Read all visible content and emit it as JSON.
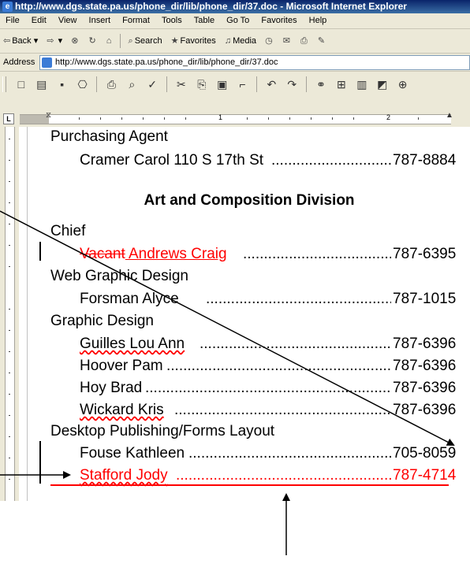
{
  "window": {
    "title": "http://www.dgs.state.pa.us/phone_dir/lib/phone_dir/37.doc - Microsoft Internet Explorer"
  },
  "menu": [
    "File",
    "Edit",
    "View",
    "Insert",
    "Format",
    "Tools",
    "Table",
    "Go To",
    "Favorites",
    "Help"
  ],
  "nav": {
    "back": "Back",
    "search": "Search",
    "favorites": "Favorites",
    "media": "Media"
  },
  "address": {
    "label": "Address",
    "url": "http://www.dgs.state.pa.us/phone_dir/lib/phone_dir/37.doc"
  },
  "ruler": {
    "marks": [
      "1",
      "2"
    ]
  },
  "document": {
    "purchasing_agent": "Purchasing Agent",
    "cramer": {
      "name": "Cramer Carol 110 S 17th St",
      "phone": "787-8884"
    },
    "division_heading": "Art and Composition Division",
    "chief": "Chief",
    "chief_entry": {
      "deleted": "Vacant",
      "inserted": " Andrews Craig",
      "phone": "787-6395"
    },
    "web_graphic_design": "Web Graphic Design",
    "forsman": {
      "name": "Forsman Alyce",
      "phone": "787-1015"
    },
    "graphic_design": "Graphic Design",
    "guilles": {
      "name": "Guilles Lou Ann",
      "phone": "787-6396"
    },
    "hoover": {
      "name": "Hoover Pam",
      "phone": "787-6396"
    },
    "hoy": {
      "name": "Hoy Brad",
      "phone": "787-6396"
    },
    "wickard": {
      "name": "Wickard Kris",
      "phone": "787-6396"
    },
    "desktop_publishing": "Desktop Publishing/Forms Layout",
    "fouse": {
      "name": "Fouse Kathleen",
      "phone": "705-8059"
    },
    "stafford": {
      "name": "Stafford Jody",
      "phone": "787-4714"
    }
  },
  "colors": {
    "titlebar": "#0A246A",
    "chrome": "#ECE9D8",
    "revision": "#FF0000"
  },
  "icons": [
    "ie-icon",
    "back-arrow-icon",
    "forward-arrow-icon",
    "stop-icon",
    "refresh-icon",
    "home-icon",
    "search-icon",
    "favorites-icon",
    "media-icon",
    "history-icon",
    "mail-icon",
    "print-icon",
    "edit-icon",
    "page-icon",
    "new-icon",
    "open-icon",
    "save-icon",
    "permission-icon",
    "print-preview-icon",
    "spelling-icon",
    "cut-icon",
    "copy-icon",
    "paste-icon",
    "format-painter-icon",
    "undo-icon",
    "redo-icon",
    "hyperlink-icon",
    "table-icon",
    "columns-icon",
    "drawing-icon",
    "zoom-icon"
  ]
}
